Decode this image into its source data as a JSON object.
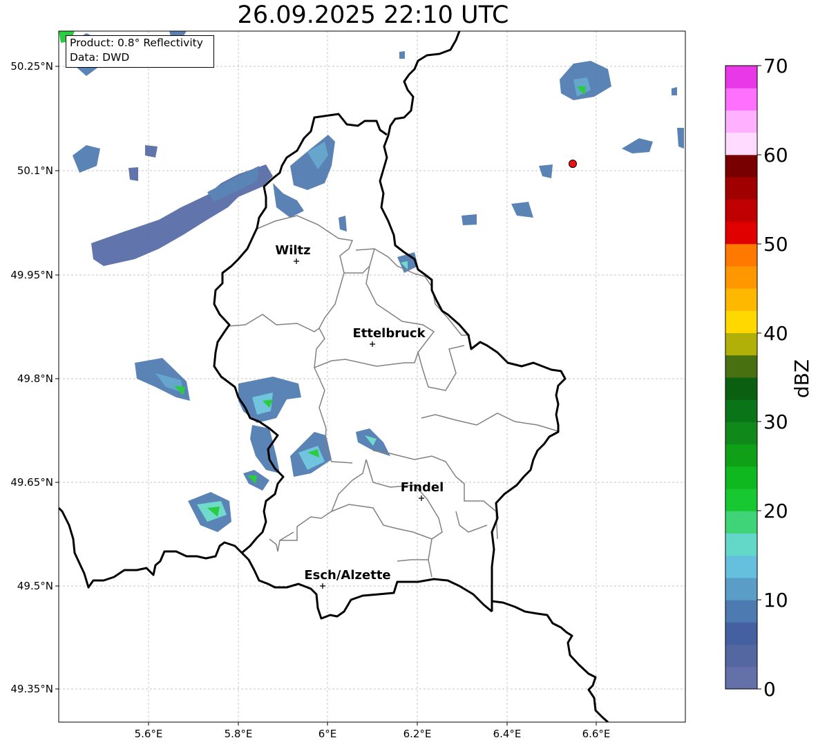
{
  "title": "26.09.2025 22:10 UTC",
  "info_box": {
    "line1": "Product: 0.8° Reflectivity",
    "line2": "Data: DWD"
  },
  "map": {
    "lon_ticks": [
      "5.6°E",
      "5.8°E",
      "6°E",
      "6.2°E",
      "6.4°E",
      "6.6°E"
    ],
    "lat_ticks": [
      "50.25°N",
      "50.1°N",
      "49.95°N",
      "49.8°N",
      "49.65°N",
      "49.5°N",
      "49.35°N"
    ],
    "cities": [
      {
        "name": "Wiltz"
      },
      {
        "name": "Ettelbruck"
      },
      {
        "name": "Findel"
      },
      {
        "name": "Esch/Alzette"
      }
    ],
    "marker_color": "#ee1111"
  },
  "colorbar": {
    "label": "dBZ",
    "ticks": [
      "0",
      "10",
      "20",
      "30",
      "40",
      "50",
      "60",
      "70"
    ],
    "colors": [
      "#6470a8",
      "#5467a0",
      "#4560a0",
      "#4d7ab0",
      "#5a9ec8",
      "#64c0dc",
      "#64d8c8",
      "#40d478",
      "#18c830",
      "#10b820",
      "#10a018",
      "#10881a",
      "#0a7418",
      "#0a6010",
      "#487010",
      "#b0b008",
      "#ffd800",
      "#ffb800",
      "#ff9800",
      "#ff7800",
      "#e00000",
      "#c00000",
      "#a00000",
      "#780000",
      "#ffdcff",
      "#ffb0ff",
      "#ff70ff",
      "#e838e8"
    ]
  }
}
